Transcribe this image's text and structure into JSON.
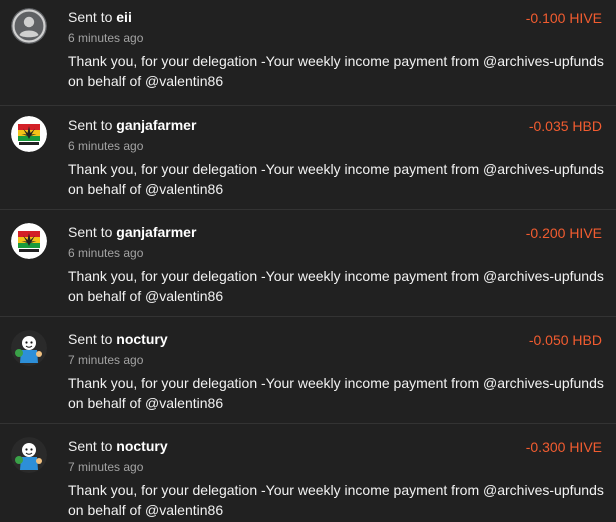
{
  "transactions": [
    {
      "prefix": "Sent to",
      "recipient": "eii",
      "time": "6 minutes ago",
      "memo": "Thank you, for your delegation -Your weekly income payment from @archives-upfunds on behalf of @valentin86",
      "amount": "-0.100 HIVE",
      "avatar": "default-user-icon"
    },
    {
      "prefix": "Sent to",
      "recipient": "ganjafarmer",
      "time": "6 minutes ago",
      "memo": "Thank you, for your delegation -Your weekly income payment from @archives-upfunds on behalf of @valentin86",
      "amount": "-0.035 HBD",
      "avatar": "ganja-farmer-logo"
    },
    {
      "prefix": "Sent to",
      "recipient": "ganjafarmer",
      "time": "6 minutes ago",
      "memo": "Thank you, for your delegation -Your weekly income payment from @archives-upfunds on behalf of @valentin86",
      "amount": "-0.200 HIVE",
      "avatar": "ganja-farmer-logo"
    },
    {
      "prefix": "Sent to",
      "recipient": "noctury",
      "time": "7 minutes ago",
      "memo": "Thank you, for your delegation -Your weekly income payment from @archives-upfunds on behalf of @valentin86",
      "amount": "-0.050 HBD",
      "avatar": "cartoon-character-avatar"
    },
    {
      "prefix": "Sent to",
      "recipient": "noctury",
      "time": "7 minutes ago",
      "memo": "Thank you, for your delegation -Your weekly income payment from @archives-upfunds on behalf of @valentin86",
      "amount": "-0.300 HIVE",
      "avatar": "cartoon-character-avatar"
    }
  ],
  "colors": {
    "background": "#212121",
    "amount": "#f25c30",
    "time": "#a3a3a3",
    "divider": "#333333"
  }
}
